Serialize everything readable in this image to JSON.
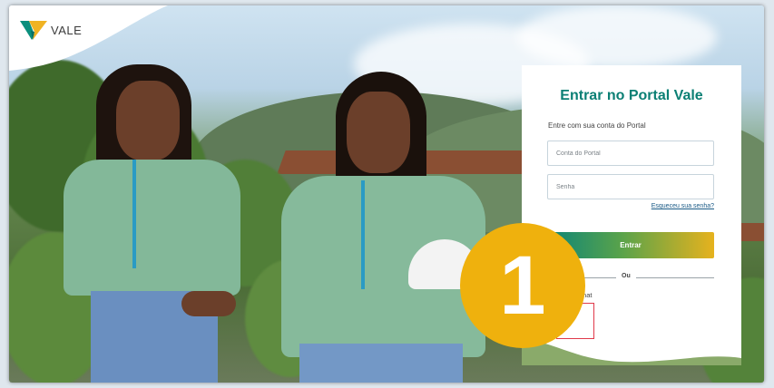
{
  "brand": {
    "name": "VALE"
  },
  "login": {
    "title": "Entrar no Portal Vale",
    "subtitle": "Entre com sua conta do Portal",
    "username_placeholder": "Conta do Portal",
    "password_placeholder": "Senha",
    "forgot_link": "Esqueceu sua senha?",
    "submit_label": "Entrar",
    "divider_label": "Ou",
    "wechat_label": "m seu WeChat"
  },
  "overlay": {
    "badge_number": "1",
    "badge_color": "#efb10d"
  },
  "colors": {
    "title": "#0b7f74",
    "button_start": "#0d8578",
    "button_end": "#e6b21e",
    "wechat_outline": "#e0394a"
  }
}
